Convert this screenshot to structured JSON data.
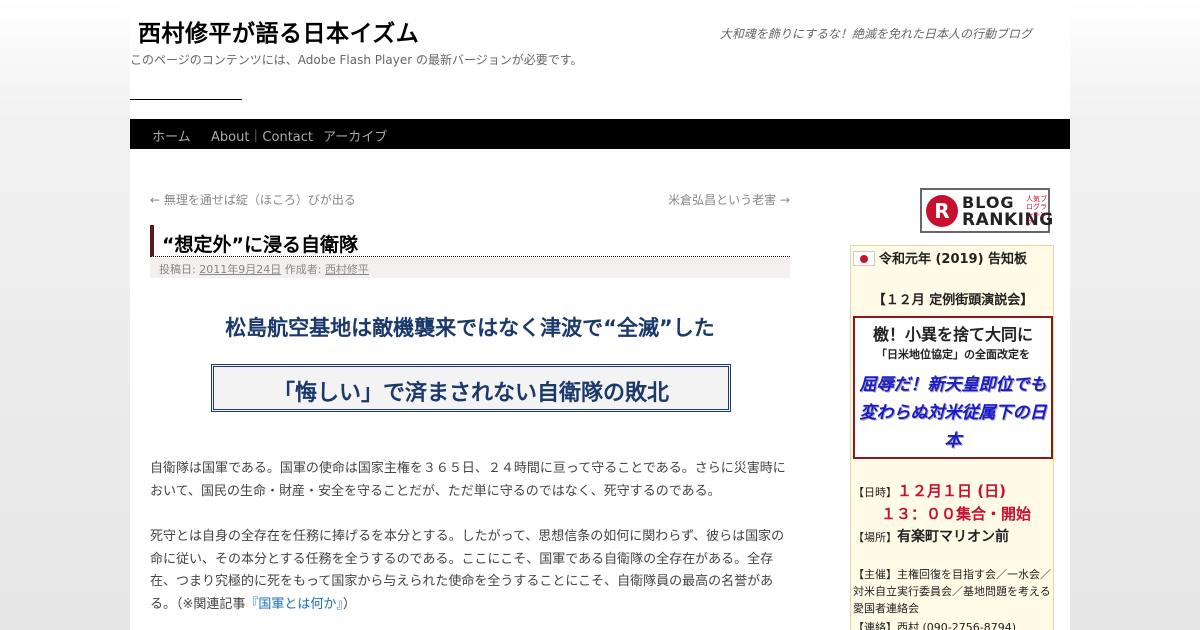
{
  "site": {
    "title": "西村修平が語る日本イズム",
    "description": "大和魂を飾りにするな！絶滅を免れた日本人の行動ブログ",
    "flash_notice": "このページのコンテンツには、Adobe Flash Player の最新バージョンが必要です。"
  },
  "nav": {
    "items": [
      {
        "label": "ホーム"
      },
      {
        "label": "About｜Contact"
      },
      {
        "label": "アーカイブ"
      }
    ]
  },
  "post_nav": {
    "prev_arrow": "←",
    "prev_label": "無理を通せば綻（ほころ）びが出る",
    "next_label": "米倉弘昌という老害",
    "next_arrow": "→"
  },
  "entry": {
    "title": "“想定外”に浸る自衛隊",
    "meta_posted": "投稿日:",
    "meta_date": "2011年9月24日",
    "meta_author_prefix": "作成者:",
    "meta_author": "西村修平",
    "headline1": "松島航空基地は敵機襲来ではなく津波で“全滅”した",
    "headline2": "「悔しい」で済まされない自衛隊の敗北",
    "paragraph1": "自衛隊は国軍である。国軍の使命は国家主権を３６５日、２４時間に亘って守ることである。さらに災害時において、国民の生命・財産・安全を守ることだが、ただ単に守るのではなく、死守するのである。",
    "paragraph2_text": "死守とは自身の全存在を任務に捧げるを本分とする。したがって、思想信条の如何に関わらず、彼らは国家の命に従い、その本分とする任務を全うするのである。ここにこそ、国軍である自衛隊の全存在がある。全存在、つまり究極的に死をもって国家から与えられた使命を全うすることにこそ、自衛隊員の最高の名誉がある。（※関連記事",
    "paragraph2_link": "『国軍とは何か』",
    "paragraph2_end": "）"
  },
  "sidebar": {
    "banner": {
      "r": "R",
      "line1": "BLOG",
      "line2": "RANKING",
      "small": "人気ブログランキング"
    },
    "notice": {
      "title": "令和元年 (2019) 告知板",
      "subtitle": "【１２月 定例街頭演説会】",
      "box_line1": "檄！小異を捨て大同に",
      "box_line2": "「日米地位協定」の全面改定を",
      "box_line3": "屈辱だ！新天皇即位でも変わらぬ対米従属下の日本",
      "date_label": "【日時】",
      "date_value": "１２月１日 (日)",
      "time_value": "１３：００集合・開始",
      "place_label": "【場所】",
      "place_value": "有楽町マリオン前",
      "organizers": "【主催】主権回復を目指す会／一水会／対米自立実行委員会／基地問題を考える愛国者連絡会",
      "contact": "【連絡】西村 (090-2756-8794)"
    }
  },
  "colors": {
    "headline": "#1b3a6b",
    "link": "#1a6fb5",
    "accent_red": "#c8102e",
    "nav_bg": "#000000"
  }
}
